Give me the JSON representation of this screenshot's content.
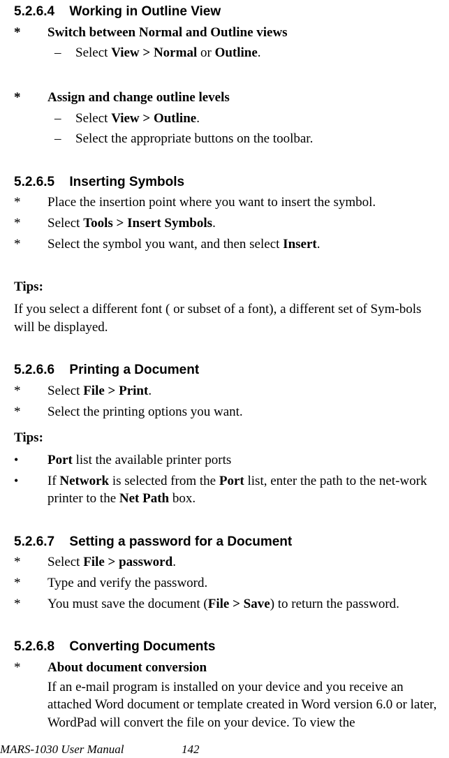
{
  "sections": {
    "s5264": {
      "num": "5.2.6.4",
      "title": "Working in Outline View"
    },
    "s5265": {
      "num": "5.2.6.5",
      "title": "Inserting Symbols"
    },
    "s5266": {
      "num": "5.2.6.6",
      "title": "Printing a Document"
    },
    "s5267": {
      "num": "5.2.6.7",
      "title": "Setting a password for a Document"
    },
    "s5268": {
      "num": "5.2.6.8",
      "title": "Converting Documents"
    }
  },
  "outline": {
    "star1": "Switch between Normal and Outline views",
    "dash1a_pre": "Select ",
    "dash1a_b1": "View > Normal",
    "dash1a_mid": " or ",
    "dash1a_b2": "Outline",
    "dash1a_post": ".",
    "star2": "Assign and change outline levels",
    "dash2a_pre": "Select ",
    "dash2a_b": "View > Outline",
    "dash2a_post": ".",
    "dash2b": "Select the appropriate buttons on the toolbar."
  },
  "symbols": {
    "s1": "Place the insertion point where you want to insert the symbol.",
    "s2_pre": "Select ",
    "s2_b": "Tools > Insert Symbols",
    "s2_post": ".",
    "s3_pre": "Select the symbol you want, and then select ",
    "s3_b": "Insert",
    "s3_post": "."
  },
  "tips_label": "Tips:",
  "tips_symbols": "If you select a different font ( or subset of a font), a different set of Sym-bols will be displayed.",
  "print": {
    "s1_pre": "Select ",
    "s1_b": "File > Print",
    "s1_post": ".",
    "s2": "Select the printing options you want.",
    "tip1_b": "Port",
    "tip1_post": " list the available printer ports",
    "tip2_pre": "If ",
    "tip2_b1": "Network",
    "tip2_mid1": " is selected from the ",
    "tip2_b2": "Port",
    "tip2_mid2": " list, enter the path to the net-work printer to the ",
    "tip2_b3": "Net Path",
    "tip2_post": " box."
  },
  "password": {
    "s1_pre": "Select ",
    "s1_b": "File > password",
    "s1_post": ".",
    "s2": "Type and verify the password.",
    "s3_pre": "You must save the document (",
    "s3_b": "File > Save",
    "s3_post": ") to return the password."
  },
  "convert": {
    "s1_b": "About document conversion",
    "s1_body": "If an e-mail program is installed on your device and you receive an attached Word document or template created in Word version 6.0 or later, WordPad will convert the file on your device. To view the"
  },
  "footer": {
    "title": "MARS-1030 User Manual",
    "page": "142"
  },
  "glyphs": {
    "star": "*",
    "dash": "–",
    "bullet": "•"
  }
}
